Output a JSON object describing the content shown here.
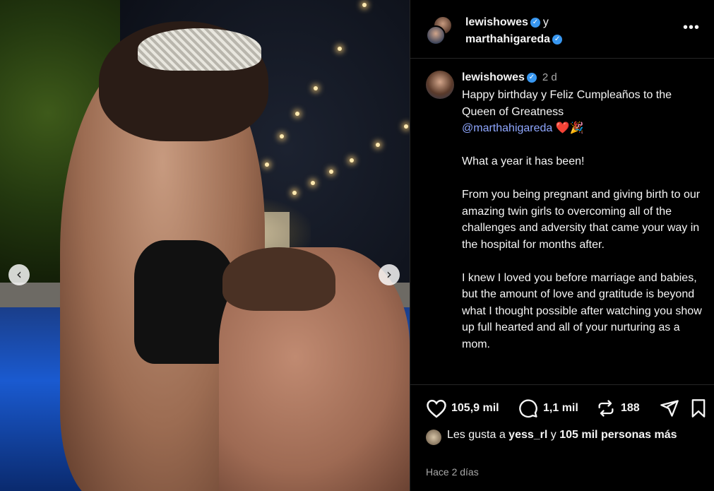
{
  "header": {
    "user1": "lewishowes",
    "joiner": "y",
    "user2": "marthahigareda",
    "more_label": "•••"
  },
  "post": {
    "username": "lewishowes",
    "time": "2 d",
    "caption_line1": "Happy birthday y Feliz Cumpleaños to the Queen of Greatness",
    "mention": "@marthahigareda",
    "emoji": " ❤️🎉",
    "caption_rest": "\n\nWhat a year it has been!\n\nFrom you being pregnant and giving birth to our amazing twin girls to overcoming all of the challenges and adversity that came your way in the hospital for months after.\n\nI knew I loved you before marriage and babies, but the amount of love and gratitude is beyond what I thought possible after watching you show up full hearted and all of your nurturing as a mom."
  },
  "actions": {
    "likes_count": "105,9 mil",
    "comments_count": "1,1 mil",
    "reposts_count": "188"
  },
  "likes": {
    "prefix": "Les gusta a ",
    "user": "yess_rl",
    "middle": " y ",
    "others": "105 mil personas más"
  },
  "timestamp": "Hace 2 días",
  "carousel": {
    "prev": "‹",
    "next": "›"
  },
  "icons": {
    "verified": "✓",
    "heart": "heart-icon",
    "comment": "comment-icon",
    "repost": "repost-icon",
    "share": "share-icon",
    "save": "bookmark-icon"
  },
  "colors": {
    "background": "#000000",
    "verified": "#3897f0",
    "mention": "#8fa7ff",
    "muted": "#a8a8a8"
  }
}
